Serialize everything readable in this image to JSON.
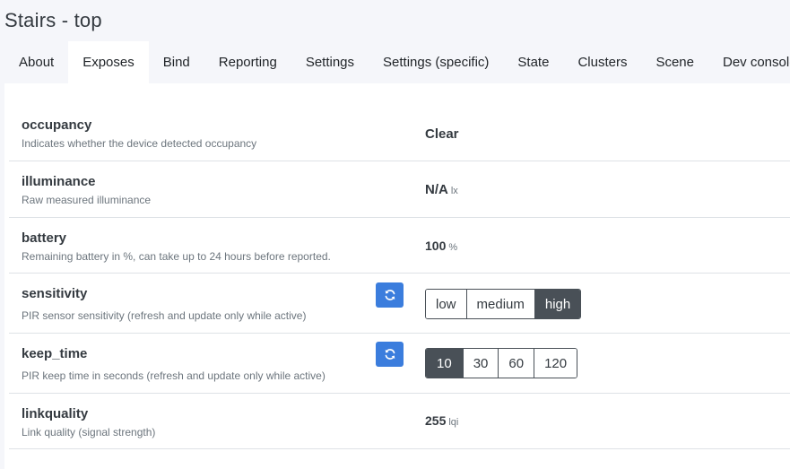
{
  "page": {
    "title": "Stairs - top"
  },
  "tabs": [
    {
      "label": "About",
      "active": false
    },
    {
      "label": "Exposes",
      "active": true
    },
    {
      "label": "Bind",
      "active": false
    },
    {
      "label": "Reporting",
      "active": false
    },
    {
      "label": "Settings",
      "active": false
    },
    {
      "label": "Settings (specific)",
      "active": false
    },
    {
      "label": "State",
      "active": false
    },
    {
      "label": "Clusters",
      "active": false
    },
    {
      "label": "Scene",
      "active": false
    },
    {
      "label": "Dev console",
      "active": false
    }
  ],
  "exposes": {
    "occupancy": {
      "name": "occupancy",
      "description": "Indicates whether the device detected occupancy",
      "value": "Clear"
    },
    "illuminance": {
      "name": "illuminance",
      "description": "Raw measured illuminance",
      "value": "N/A",
      "unit": "lx"
    },
    "battery": {
      "name": "battery",
      "description": "Remaining battery in %, can take up to 24 hours before reported.",
      "value": "100",
      "unit": "%"
    },
    "sensitivity": {
      "name": "sensitivity",
      "description": "PIR sensor sensitivity (refresh and update only while active)",
      "options": [
        "low",
        "medium",
        "high"
      ],
      "selected": "high"
    },
    "keep_time": {
      "name": "keep_time",
      "description": "PIR keep time in seconds (refresh and update only while active)",
      "options": [
        "10",
        "30",
        "60",
        "120"
      ],
      "selected": "10"
    },
    "linkquality": {
      "name": "linkquality",
      "description": "Link quality (signal strength)",
      "value": "255",
      "unit": "lqi"
    }
  },
  "icons": {
    "refresh": "refresh-icon"
  },
  "colors": {
    "accent": "#3b7ddd",
    "selected": "#495057"
  }
}
